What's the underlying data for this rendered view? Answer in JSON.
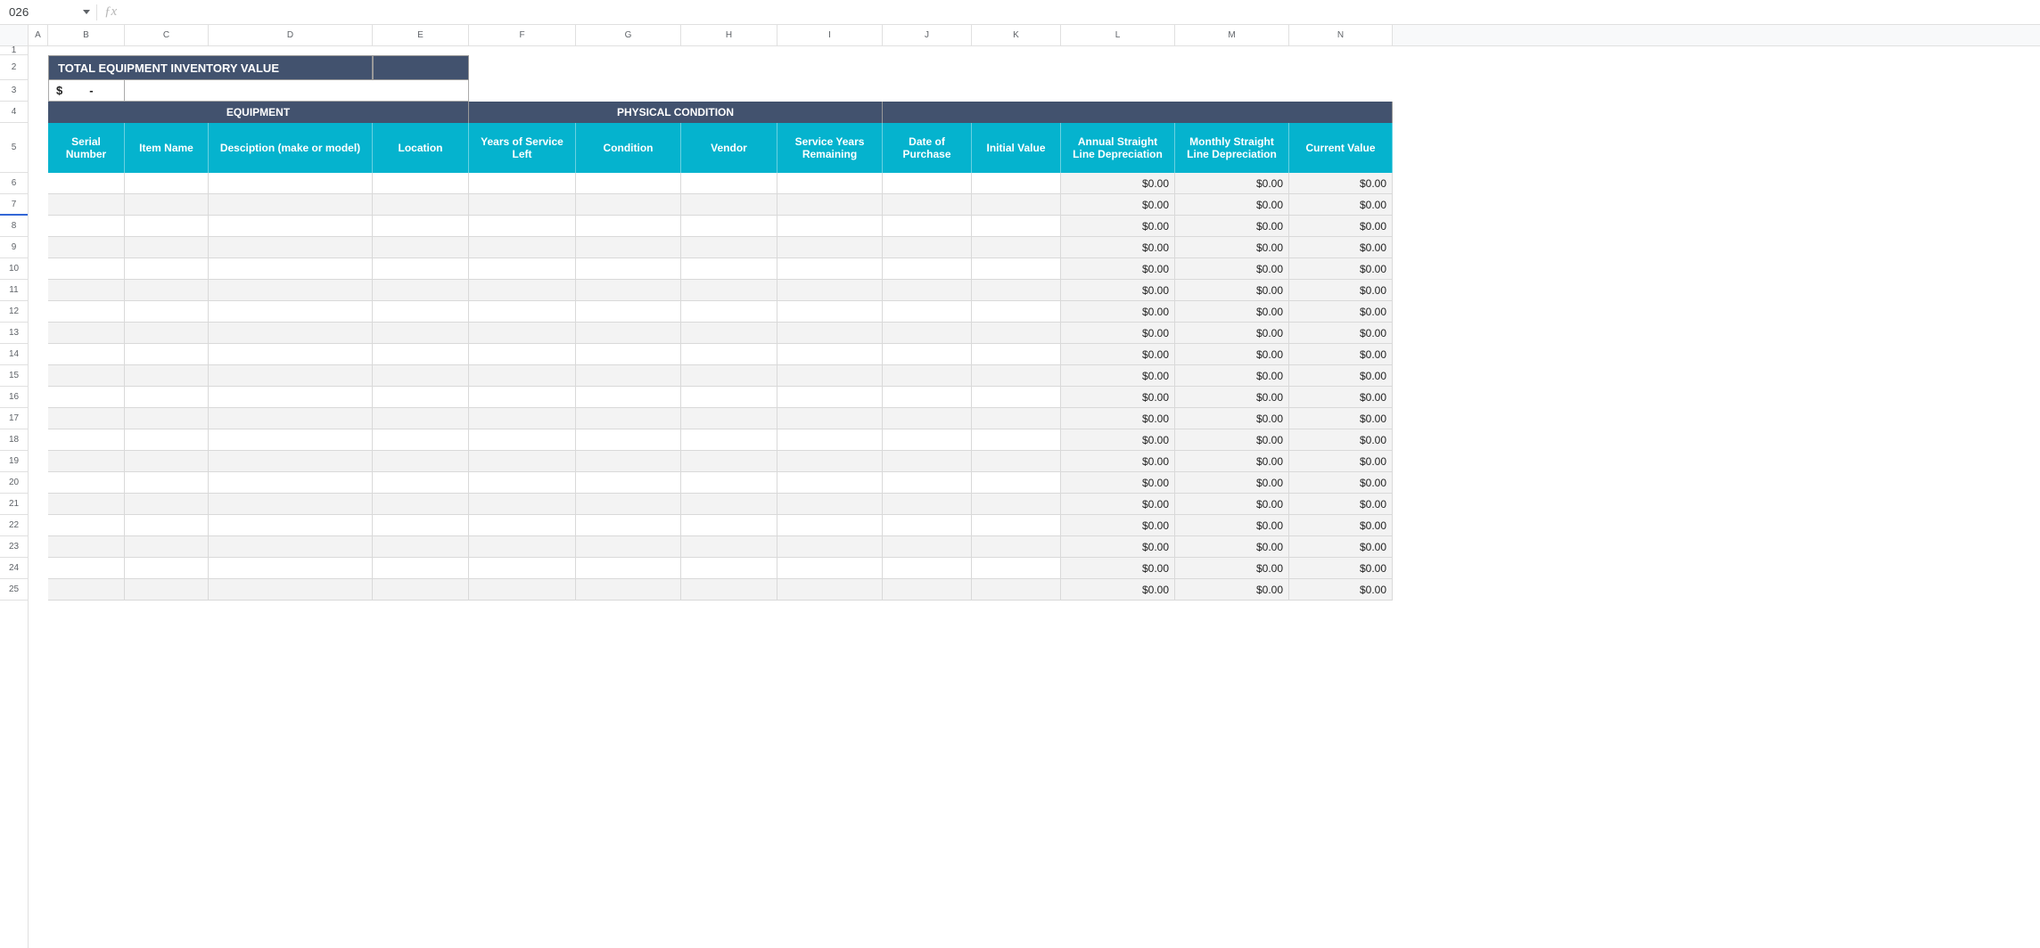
{
  "name_box": "026",
  "formula_input": "",
  "fx_label": "ƒx",
  "column_letters": [
    "A",
    "B",
    "C",
    "D",
    "E",
    "F",
    "G",
    "H",
    "I",
    "J",
    "K",
    "L",
    "M",
    "N"
  ],
  "row_numbers": [
    1,
    2,
    3,
    4,
    5,
    6,
    7,
    8,
    9,
    10,
    11,
    12,
    13,
    14,
    15,
    16,
    17,
    18,
    19,
    20,
    21,
    22,
    23,
    24,
    25
  ],
  "banner_title": "TOTAL EQUIPMENT INVENTORY VALUE",
  "total_value": {
    "currency": "$",
    "amount": "-"
  },
  "section_headers": {
    "equipment": "EQUIPMENT",
    "physical_condition": "PHYSICAL CONDITION",
    "financials": ""
  },
  "column_labels": {
    "serial_number": "Serial Number",
    "item_name": "Item Name",
    "description": "Desciption (make or model)",
    "location": "Location",
    "years_of_service_left": "Years of Service Left",
    "condition": "Condition",
    "vendor": "Vendor",
    "service_years_remaining": "Service Years Remaining",
    "date_of_purchase": "Date of Purchase",
    "initial_value": "Initial Value",
    "annual_depr": "Annual Straight Line Depreciation",
    "monthly_depr": "Monthly Straight Line Depreciation",
    "current_value": "Current Value"
  },
  "data_rows": [
    {
      "serial_number": "",
      "item_name": "",
      "description": "",
      "location": "",
      "years_of_service_left": "",
      "condition": "",
      "vendor": "",
      "service_years_remaining": "",
      "date_of_purchase": "",
      "initial_value": "",
      "annual_depr": "$0.00",
      "monthly_depr": "$0.00",
      "current_value": "$0.00"
    },
    {
      "serial_number": "",
      "item_name": "",
      "description": "",
      "location": "",
      "years_of_service_left": "",
      "condition": "",
      "vendor": "",
      "service_years_remaining": "",
      "date_of_purchase": "",
      "initial_value": "",
      "annual_depr": "$0.00",
      "monthly_depr": "$0.00",
      "current_value": "$0.00"
    },
    {
      "serial_number": "",
      "item_name": "",
      "description": "",
      "location": "",
      "years_of_service_left": "",
      "condition": "",
      "vendor": "",
      "service_years_remaining": "",
      "date_of_purchase": "",
      "initial_value": "",
      "annual_depr": "$0.00",
      "monthly_depr": "$0.00",
      "current_value": "$0.00"
    },
    {
      "serial_number": "",
      "item_name": "",
      "description": "",
      "location": "",
      "years_of_service_left": "",
      "condition": "",
      "vendor": "",
      "service_years_remaining": "",
      "date_of_purchase": "",
      "initial_value": "",
      "annual_depr": "$0.00",
      "monthly_depr": "$0.00",
      "current_value": "$0.00"
    },
    {
      "serial_number": "",
      "item_name": "",
      "description": "",
      "location": "",
      "years_of_service_left": "",
      "condition": "",
      "vendor": "",
      "service_years_remaining": "",
      "date_of_purchase": "",
      "initial_value": "",
      "annual_depr": "$0.00",
      "monthly_depr": "$0.00",
      "current_value": "$0.00"
    },
    {
      "serial_number": "",
      "item_name": "",
      "description": "",
      "location": "",
      "years_of_service_left": "",
      "condition": "",
      "vendor": "",
      "service_years_remaining": "",
      "date_of_purchase": "",
      "initial_value": "",
      "annual_depr": "$0.00",
      "monthly_depr": "$0.00",
      "current_value": "$0.00"
    },
    {
      "serial_number": "",
      "item_name": "",
      "description": "",
      "location": "",
      "years_of_service_left": "",
      "condition": "",
      "vendor": "",
      "service_years_remaining": "",
      "date_of_purchase": "",
      "initial_value": "",
      "annual_depr": "$0.00",
      "monthly_depr": "$0.00",
      "current_value": "$0.00"
    },
    {
      "serial_number": "",
      "item_name": "",
      "description": "",
      "location": "",
      "years_of_service_left": "",
      "condition": "",
      "vendor": "",
      "service_years_remaining": "",
      "date_of_purchase": "",
      "initial_value": "",
      "annual_depr": "$0.00",
      "monthly_depr": "$0.00",
      "current_value": "$0.00"
    },
    {
      "serial_number": "",
      "item_name": "",
      "description": "",
      "location": "",
      "years_of_service_left": "",
      "condition": "",
      "vendor": "",
      "service_years_remaining": "",
      "date_of_purchase": "",
      "initial_value": "",
      "annual_depr": "$0.00",
      "monthly_depr": "$0.00",
      "current_value": "$0.00"
    },
    {
      "serial_number": "",
      "item_name": "",
      "description": "",
      "location": "",
      "years_of_service_left": "",
      "condition": "",
      "vendor": "",
      "service_years_remaining": "",
      "date_of_purchase": "",
      "initial_value": "",
      "annual_depr": "$0.00",
      "monthly_depr": "$0.00",
      "current_value": "$0.00"
    },
    {
      "serial_number": "",
      "item_name": "",
      "description": "",
      "location": "",
      "years_of_service_left": "",
      "condition": "",
      "vendor": "",
      "service_years_remaining": "",
      "date_of_purchase": "",
      "initial_value": "",
      "annual_depr": "$0.00",
      "monthly_depr": "$0.00",
      "current_value": "$0.00"
    },
    {
      "serial_number": "",
      "item_name": "",
      "description": "",
      "location": "",
      "years_of_service_left": "",
      "condition": "",
      "vendor": "",
      "service_years_remaining": "",
      "date_of_purchase": "",
      "initial_value": "",
      "annual_depr": "$0.00",
      "monthly_depr": "$0.00",
      "current_value": "$0.00"
    },
    {
      "serial_number": "",
      "item_name": "",
      "description": "",
      "location": "",
      "years_of_service_left": "",
      "condition": "",
      "vendor": "",
      "service_years_remaining": "",
      "date_of_purchase": "",
      "initial_value": "",
      "annual_depr": "$0.00",
      "monthly_depr": "$0.00",
      "current_value": "$0.00"
    },
    {
      "serial_number": "",
      "item_name": "",
      "description": "",
      "location": "",
      "years_of_service_left": "",
      "condition": "",
      "vendor": "",
      "service_years_remaining": "",
      "date_of_purchase": "",
      "initial_value": "",
      "annual_depr": "$0.00",
      "monthly_depr": "$0.00",
      "current_value": "$0.00"
    },
    {
      "serial_number": "",
      "item_name": "",
      "description": "",
      "location": "",
      "years_of_service_left": "",
      "condition": "",
      "vendor": "",
      "service_years_remaining": "",
      "date_of_purchase": "",
      "initial_value": "",
      "annual_depr": "$0.00",
      "monthly_depr": "$0.00",
      "current_value": "$0.00"
    },
    {
      "serial_number": "",
      "item_name": "",
      "description": "",
      "location": "",
      "years_of_service_left": "",
      "condition": "",
      "vendor": "",
      "service_years_remaining": "",
      "date_of_purchase": "",
      "initial_value": "",
      "annual_depr": "$0.00",
      "monthly_depr": "$0.00",
      "current_value": "$0.00"
    },
    {
      "serial_number": "",
      "item_name": "",
      "description": "",
      "location": "",
      "years_of_service_left": "",
      "condition": "",
      "vendor": "",
      "service_years_remaining": "",
      "date_of_purchase": "",
      "initial_value": "",
      "annual_depr": "$0.00",
      "monthly_depr": "$0.00",
      "current_value": "$0.00"
    },
    {
      "serial_number": "",
      "item_name": "",
      "description": "",
      "location": "",
      "years_of_service_left": "",
      "condition": "",
      "vendor": "",
      "service_years_remaining": "",
      "date_of_purchase": "",
      "initial_value": "",
      "annual_depr": "$0.00",
      "monthly_depr": "$0.00",
      "current_value": "$0.00"
    },
    {
      "serial_number": "",
      "item_name": "",
      "description": "",
      "location": "",
      "years_of_service_left": "",
      "condition": "",
      "vendor": "",
      "service_years_remaining": "",
      "date_of_purchase": "",
      "initial_value": "",
      "annual_depr": "$0.00",
      "monthly_depr": "$0.00",
      "current_value": "$0.00"
    },
    {
      "serial_number": "",
      "item_name": "",
      "description": "",
      "location": "",
      "years_of_service_left": "",
      "condition": "",
      "vendor": "",
      "service_years_remaining": "",
      "date_of_purchase": "",
      "initial_value": "",
      "annual_depr": "$0.00",
      "monthly_depr": "$0.00",
      "current_value": "$0.00"
    }
  ],
  "col_widths": {
    "A": 22,
    "B": 86,
    "C": 94,
    "D": 184,
    "E": 108,
    "F": 120,
    "G": 118,
    "H": 108,
    "I": 118,
    "J": 100,
    "K": 100,
    "L": 128,
    "M": 128,
    "N": 116
  },
  "row_heights": {
    "1": 10,
    "2": 28,
    "3": 24,
    "4": 24,
    "5": 56,
    "default": 24
  },
  "active_row_marker": 7
}
